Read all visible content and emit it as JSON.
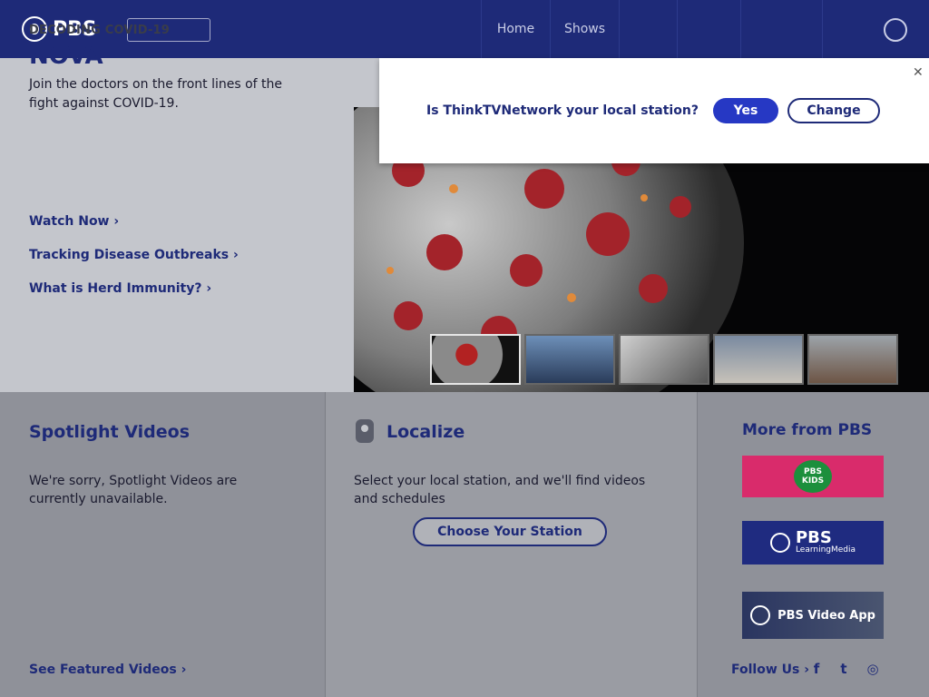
{
  "header": {
    "logo_text": "PBS",
    "nav": {
      "home": "Home",
      "shows": "Shows"
    }
  },
  "hero": {
    "eyebrow": "DECODING COVID-19",
    "title": "NOVA",
    "description": "Join the doctors on the front lines of the fight against COVID-19.",
    "links": {
      "watch": "Watch Now ›",
      "tracking": "Tracking Disease Outbreaks ›",
      "herd": "What is Herd Immunity? ›"
    }
  },
  "station_prompt": {
    "question": "Is ThinkTVNetwork your local station?",
    "yes_label": "Yes",
    "change_label": "Change",
    "close_glyph": "✕"
  },
  "spotlight": {
    "title": "Spotlight Videos",
    "message": "We're sorry, Spotlight Videos are currently unavailable.",
    "footer_link": "See Featured Videos ›"
  },
  "localize": {
    "title": "Localize",
    "message": "Select your local station, and we'll find videos and schedules",
    "button_label": "Choose Your Station"
  },
  "more": {
    "title": "More from PBS",
    "kids_badge": "PBS KIDS",
    "learning_media_brand": "PBS",
    "learning_media_sub": "LearningMedia",
    "video_app_label": "PBS Video App",
    "follow_label": "Follow Us ›",
    "social_icons": {
      "facebook": "f",
      "twitter": "t",
      "instagram": "◎"
    }
  },
  "colors": {
    "navy": "#1e2a78",
    "header_bg": "#1e2a78",
    "yes_button": "#2638c4",
    "kids_pink": "#d92b6b",
    "kids_green": "#1c8f3c"
  }
}
